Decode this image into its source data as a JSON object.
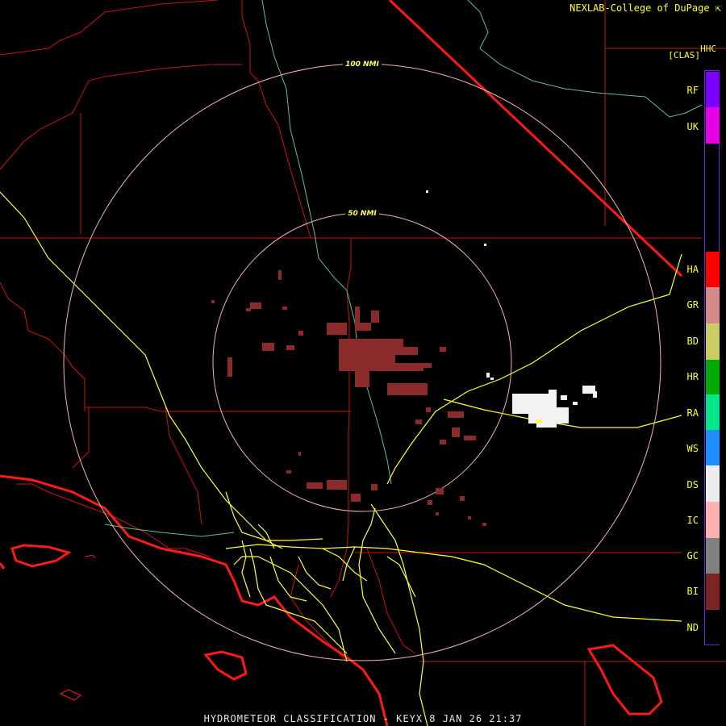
{
  "header": {
    "credit": "NEXLAB-College of DuPage ⇱",
    "product_code": "HHC",
    "product_bracket": "[CLAS]"
  },
  "range_rings": {
    "outer_label": "100 NMI",
    "inner_label": "50 NMI"
  },
  "legend": {
    "items": [
      {
        "code": "RF",
        "color": "#7a00ff"
      },
      {
        "code": "UK",
        "color": "#e600e6"
      },
      {
        "code": "HA",
        "color": "#ff0000"
      },
      {
        "code": "GR",
        "color": "#d48a8a"
      },
      {
        "code": "BD",
        "color": "#cccc66"
      },
      {
        "code": "HR",
        "color": "#00aa00"
      },
      {
        "code": "RA",
        "color": "#00e68a"
      },
      {
        "code": "WS",
        "color": "#1f8fff"
      },
      {
        "code": "DS",
        "color": "#ececec"
      },
      {
        "code": "IC",
        "color": "#ffb0b0"
      },
      {
        "code": "GC",
        "color": "#808080"
      },
      {
        "code": "BI",
        "color": "#7a2424"
      },
      {
        "code": "ND",
        "color": "#000000"
      }
    ]
  },
  "footer": {
    "title": "HYDROMETEOR CLASSIFICATION - KEYX 8 JAN 26 21:37"
  }
}
